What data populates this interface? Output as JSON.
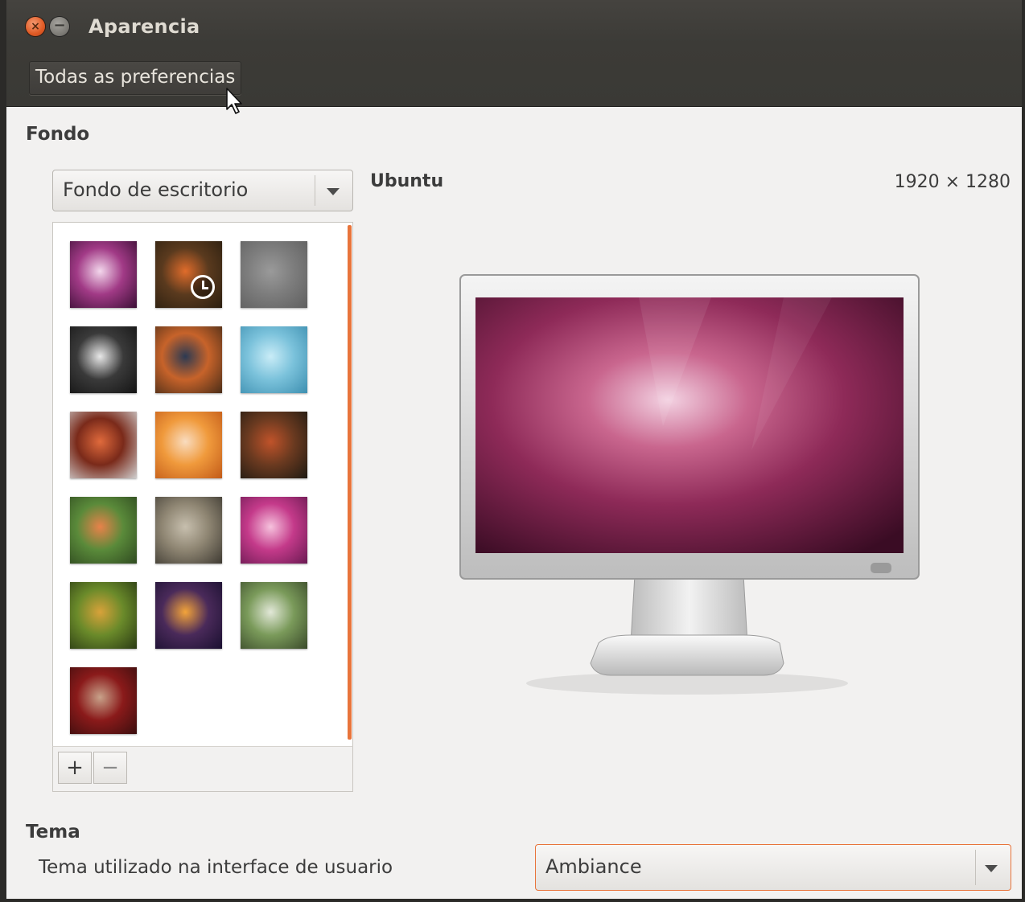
{
  "window": {
    "title": "Aparencia",
    "close_glyph": "×",
    "minimize_glyph": "−",
    "toolbar": {
      "all_settings_label": "Todas as preferencias"
    }
  },
  "background": {
    "section_title": "Fondo",
    "source_combo": {
      "selected": "Fondo de escritorio"
    },
    "add_label": "+",
    "remove_label": "−",
    "wallpaper_name": "Ubuntu",
    "wallpaper_size": "1920 × 1280",
    "thumbnails": [
      {
        "name": "wallpaper-1",
        "colors": [
          "#f3d7ec",
          "#a13a86",
          "#3b0f35"
        ]
      },
      {
        "name": "wallpaper-2",
        "colors": [
          "#e06c2b",
          "#5a3a1e",
          "#2b1f10"
        ]
      },
      {
        "name": "wallpaper-3",
        "colors": [
          "#9a9a9a",
          "#7d7d7d",
          "#5f5f5f"
        ]
      },
      {
        "name": "wallpaper-4",
        "colors": [
          "#e8e8e8",
          "#3a3a3a",
          "#141414"
        ]
      },
      {
        "name": "wallpaper-5",
        "colors": [
          "#2c3a52",
          "#c7632a",
          "#4a2d18"
        ]
      },
      {
        "name": "wallpaper-6",
        "colors": [
          "#c9ecf7",
          "#7bc2db",
          "#3d8fb0"
        ]
      },
      {
        "name": "wallpaper-7",
        "colors": [
          "#e06a3c",
          "#7a2a1a",
          "#d0cfcf"
        ]
      },
      {
        "name": "wallpaper-8",
        "colors": [
          "#f9dcbf",
          "#f09a3c",
          "#c25a18"
        ]
      },
      {
        "name": "wallpaper-9",
        "colors": [
          "#c0532a",
          "#6b3a20",
          "#1e1a12"
        ]
      },
      {
        "name": "wallpaper-10",
        "colors": [
          "#e8824a",
          "#5a8a3a",
          "#2f4a20"
        ]
      },
      {
        "name": "wallpaper-11",
        "colors": [
          "#c7bfae",
          "#8f8673",
          "#3e3a32"
        ]
      },
      {
        "name": "wallpaper-12",
        "colors": [
          "#f6c2dd",
          "#c43a8a",
          "#6a1a52"
        ]
      },
      {
        "name": "wallpaper-13",
        "colors": [
          "#d8a23a",
          "#6a8a2a",
          "#2a3a14"
        ]
      },
      {
        "name": "wallpaper-14",
        "colors": [
          "#f3a43a",
          "#4a2a5a",
          "#1a1030"
        ]
      },
      {
        "name": "wallpaper-15",
        "colors": [
          "#e2e8d8",
          "#7a9a5a",
          "#3a4a2a"
        ]
      },
      {
        "name": "wallpaper-16",
        "colors": [
          "#c8a28a",
          "#8a1a1a",
          "#3a0e0e"
        ]
      }
    ]
  },
  "theme": {
    "section_title": "Tema",
    "description": "Tema utilizado na interface de usuario",
    "combo": {
      "selected": "Ambiance"
    }
  },
  "colors": {
    "accent": "#e8743b",
    "titlebar": "#3c3b37",
    "window_bg": "#f2f1f0"
  },
  "icons": [
    "close-icon",
    "minimize-icon",
    "mouse-pointer-icon",
    "dropdown-arrow-icon",
    "clock-icon"
  ]
}
